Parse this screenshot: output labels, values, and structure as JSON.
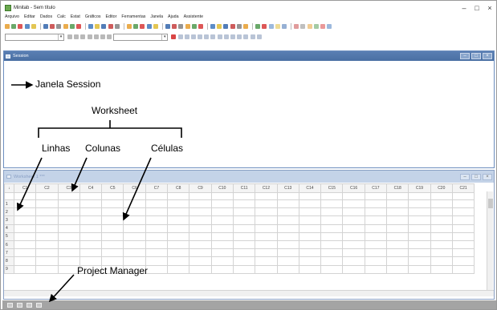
{
  "window": {
    "title": "Minitab - Sem título"
  },
  "window_controls": {
    "minimize": "–",
    "maximize": "□",
    "close": "×"
  },
  "menu": [
    "Arquivo",
    "Editar",
    "Dados",
    "Calc",
    "Estat",
    "Gráficos",
    "Editor",
    "Ferramentas",
    "Janela",
    "Ajuda",
    "Assistente"
  ],
  "session": {
    "title": "Session"
  },
  "worksheet": {
    "title": "Worksheet 1 ***",
    "columns": [
      "C1",
      "C2",
      "C3",
      "C4",
      "C5",
      "C6",
      "C7",
      "C8",
      "C9",
      "C10",
      "C11",
      "C12",
      "C13",
      "C14",
      "C15",
      "C16",
      "C17",
      "C18",
      "C19",
      "C20",
      "C21"
    ],
    "rows": [
      "1",
      "2",
      "3",
      "4",
      "5",
      "6",
      "7",
      "8",
      "9"
    ],
    "corner": "↓"
  },
  "annotations": {
    "session": "Janela Session",
    "worksheet": "Worksheet",
    "linhas": "Linhas",
    "colunas": "Colunas",
    "celulas": "Células",
    "project_manager": "Project Manager"
  },
  "toolbar_colors": [
    "#e8a33a",
    "#4a7fc1",
    "#c94a4a",
    "#5aa05a",
    "#e0c040",
    "#8a8a8a",
    "#d94545",
    "#3f6fb0"
  ]
}
